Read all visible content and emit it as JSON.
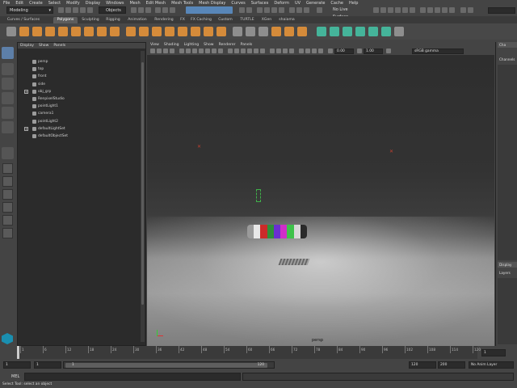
{
  "menubar": [
    "File",
    "Edit",
    "Create",
    "Select",
    "Modify",
    "Display",
    "Windows",
    "Mesh",
    "Edit Mesh",
    "Mesh Tools",
    "Mesh Display",
    "Curves",
    "Surfaces",
    "Deform",
    "UV",
    "Generate",
    "Cache",
    "Help"
  ],
  "statusline": {
    "mode": "Modeling",
    "selection_field": "Objects",
    "render_setting": "No Live Surface"
  },
  "shelf_tabs": [
    {
      "label": "Curves / Surfaces",
      "active": false
    },
    {
      "label": "Polygons",
      "active": true
    },
    {
      "label": "Sculpting",
      "active": false
    },
    {
      "label": "Rigging",
      "active": false
    },
    {
      "label": "Animation",
      "active": false
    },
    {
      "label": "Rendering",
      "active": false
    },
    {
      "label": "FX",
      "active": false
    },
    {
      "label": "FX Caching",
      "active": false
    },
    {
      "label": "Custom",
      "active": false
    },
    {
      "label": "TURTLE",
      "active": false
    },
    {
      "label": "XGen",
      "active": false
    },
    {
      "label": "shaiama",
      "active": false
    }
  ],
  "outliner": {
    "menu": [
      "Display",
      "Show",
      "Panels"
    ],
    "items": [
      {
        "label": "persp",
        "expandable": false
      },
      {
        "label": "top",
        "expandable": false
      },
      {
        "label": "front",
        "expandable": false
      },
      {
        "label": "side",
        "expandable": false
      },
      {
        "label": "obj_grp",
        "expandable": true
      },
      {
        "label": "RenpixelStudio",
        "expandable": false
      },
      {
        "label": "pointLight1",
        "expandable": false
      },
      {
        "label": "camera1",
        "expandable": false
      },
      {
        "label": "pointLight2",
        "expandable": false
      },
      {
        "label": "defaultLightSet",
        "expandable": true
      },
      {
        "label": "defaultObjectSet",
        "expandable": false
      }
    ]
  },
  "viewport": {
    "menu": [
      "View",
      "Shading",
      "Lighting",
      "Show",
      "Renderer",
      "Panels"
    ],
    "exposure": "0.00",
    "gamma": "1.00",
    "colorspace": "sRGB gamma",
    "camera_label": "persp",
    "rainbow_colors": [
      "#9a9a9a",
      "#e8e8e8",
      "#cc2a2a",
      "#2f8f3a",
      "#6a2fd1",
      "#d02ec8",
      "#3ec24a",
      "#d8d8d8",
      "#2a2a2a"
    ]
  },
  "channelbox": {
    "tab_top": "Cha",
    "label_channels": "Channels",
    "tab_display": "Display",
    "label_layers": "Layers"
  },
  "timeslider": {
    "ticks": [
      "1",
      "6",
      "12",
      "18",
      "24",
      "30",
      "36",
      "42",
      "48",
      "54",
      "60",
      "66",
      "72",
      "78",
      "84",
      "90",
      "96",
      "102",
      "108",
      "114",
      "120"
    ],
    "current_frame_field": "1"
  },
  "rangebar": {
    "start_field": "1",
    "start_inner": "1",
    "range_start_label": "1",
    "range_end_label": "120",
    "end_inner": "120",
    "end_field": "200",
    "anim_layer": "No Anim Layer"
  },
  "cmdline": {
    "label": "MEL"
  },
  "helpline": "Select Tool: select an object"
}
